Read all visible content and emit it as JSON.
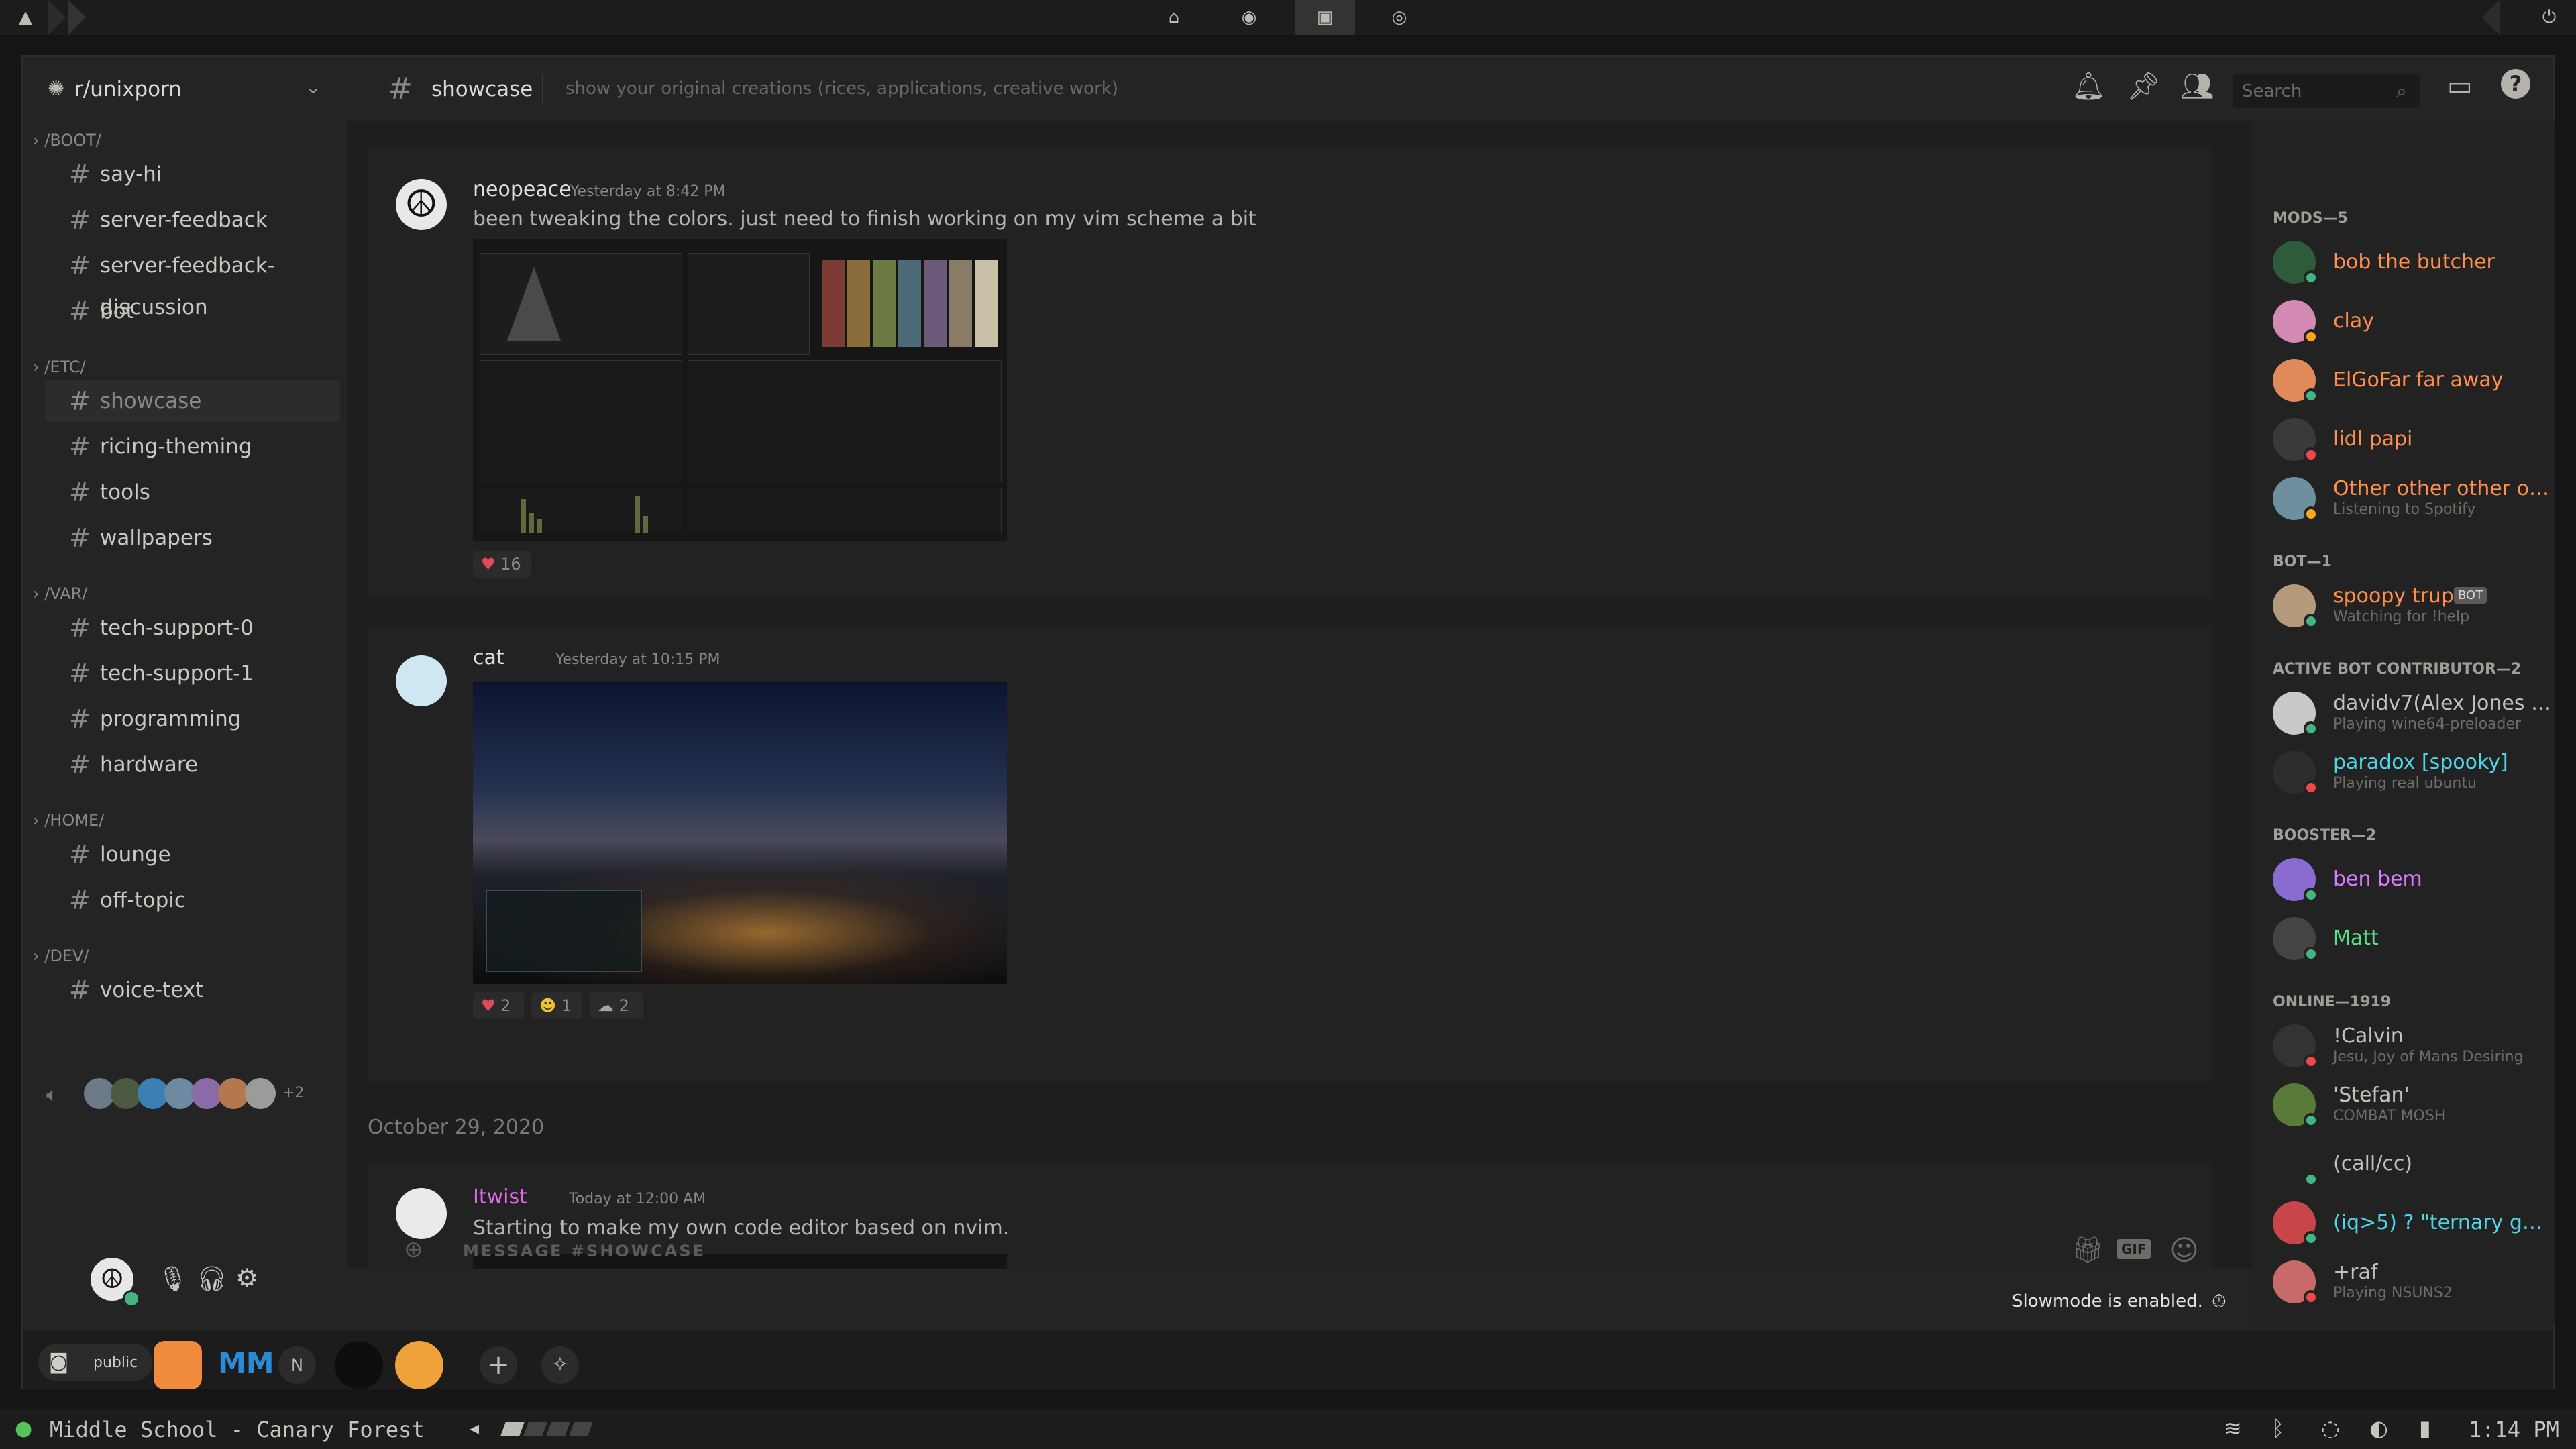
{
  "topbar": {
    "left_icon": "arch-logo-icon",
    "center_icons": [
      "home-icon",
      "chromium-icon",
      "discord-icon",
      "spotify-icon"
    ],
    "right_icon": "power-icon"
  },
  "server": {
    "name": "r/unixporn"
  },
  "categories": [
    {
      "name": "/BOOT/",
      "channels": [
        "say-hi",
        "server-feedback",
        "server-feedback-discussion",
        "bot"
      ]
    },
    {
      "name": "/ETC/",
      "channels": [
        "showcase",
        "ricing-theming",
        "tools",
        "wallpapers"
      ]
    },
    {
      "name": "/VAR/",
      "channels": [
        "tech-support-0",
        "tech-support-1",
        "programming",
        "hardware"
      ]
    },
    {
      "name": "/HOME/",
      "channels": [
        "lounge",
        "off-topic"
      ]
    },
    {
      "name": "/DEV/",
      "channels": [
        "voice-text"
      ]
    }
  ],
  "voice_more": "+2",
  "channel_header": {
    "name": "showcase",
    "topic": "show your original creations (rices, applications, creative work)",
    "search_placeholder": "Search"
  },
  "messages": [
    {
      "author": "neopeace",
      "time": "Yesterday at 8:42 PM",
      "text": "been tweaking the colors. just need to finish working on my vim scheme a bit",
      "reactions": [
        {
          "emoji": "heart",
          "count": "16"
        }
      ]
    },
    {
      "author": "cat",
      "time": "Yesterday at 10:15 PM",
      "text": "",
      "reactions": [
        {
          "emoji": "heart",
          "count": "2"
        },
        {
          "emoji": "sunglasses",
          "count": "1"
        },
        {
          "emoji": "cloud",
          "count": "2"
        }
      ]
    },
    {
      "author": "Itwist",
      "time": "Today at 12:00 AM",
      "text": "Starting to make my own code editor based on nvim.",
      "reactions": []
    }
  ],
  "date_divider": "October 29, 2020",
  "composer": {
    "placeholder": "MESSAGE #SHOWCASE",
    "slowmode": "Slowmode is enabled."
  },
  "members": {
    "groups": [
      {
        "title": "MODS—5",
        "items": [
          {
            "name": "bob the butcher",
            "status": "",
            "color": "#ff8f4a"
          },
          {
            "name": "clay",
            "status": "",
            "color": "#ff8f4a"
          },
          {
            "name": "ElGoFar far away",
            "status": "",
            "color": "#ff8f4a"
          },
          {
            "name": "lidl papi",
            "status": "",
            "color": "#ff8f4a"
          },
          {
            "name": "Other other other other...",
            "status": "Listening to Spotify",
            "color": "#ff8f4a"
          }
        ]
      },
      {
        "title": "BOT—1",
        "items": [
          {
            "name": "spoopy trup",
            "status": "Watching for !help",
            "color": "#ff8f4a",
            "badge": "BOT"
          }
        ]
      },
      {
        "title": "ACTIVE BOT CONTRIBUTOR—2",
        "items": [
          {
            "name": "davidv7(Alex Jones on J...",
            "status": "Playing wine64-preloader",
            "color": "#c4c1ba"
          },
          {
            "name": "paradox [spooky]",
            "status": "Playing real ubuntu",
            "color": "#4fd6e8"
          }
        ]
      },
      {
        "title": "BOOSTER—2",
        "items": [
          {
            "name": "ben bem",
            "status": "",
            "color": "#d77cff"
          },
          {
            "name": "Matt",
            "status": "",
            "color": "#57e389"
          }
        ]
      },
      {
        "title": "ONLINE—1919",
        "items": [
          {
            "name": "!Calvin",
            "status": "Jesu, Joy of Mans Desiring",
            "color": "#c4c1ba"
          },
          {
            "name": "'Stefan'",
            "status": "COMBAT MOSH",
            "color": "#c4c1ba"
          },
          {
            "name": "(call/cc)",
            "status": "",
            "color": "#c4c1ba"
          },
          {
            "name": "(iq>5) ? \"ternary gang\":...",
            "status": "",
            "color": "#4fd6e8"
          },
          {
            "name": "+raf",
            "status": "Playing NSUNS2",
            "color": "#c4c1ba"
          }
        ]
      }
    ]
  },
  "bottom": {
    "dm_label": "public",
    "letters": [
      "MM",
      "N"
    ]
  },
  "taskbar": {
    "now_playing": "Middle School - Canary Forest",
    "clock": "1:14 PM"
  }
}
